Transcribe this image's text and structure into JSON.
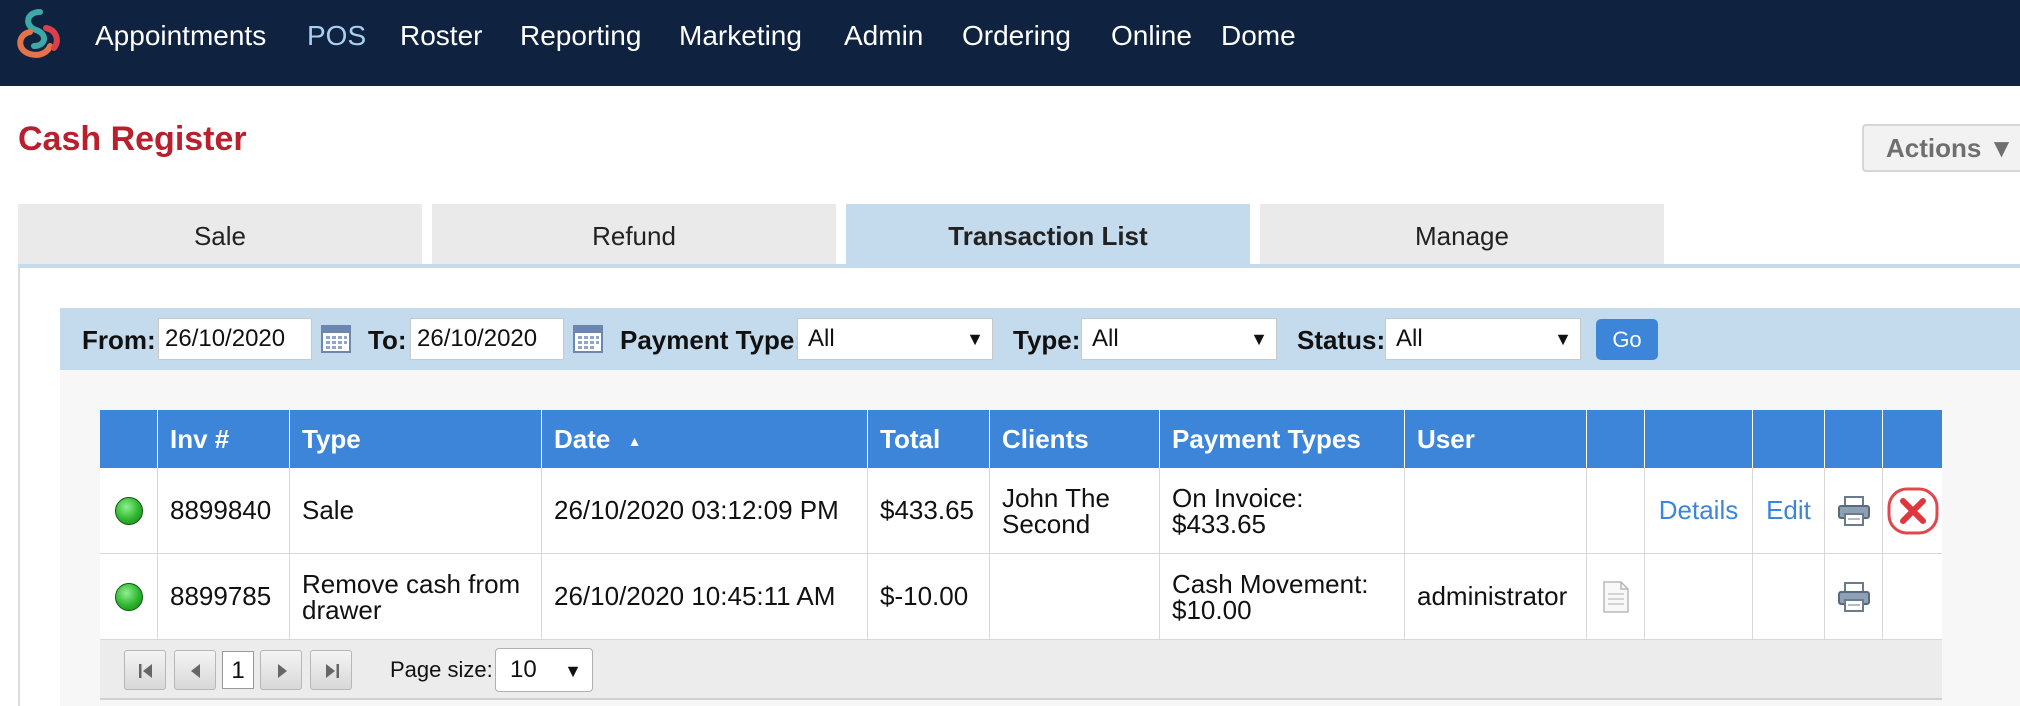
{
  "nav": {
    "items": [
      "Appointments",
      "POS",
      "Roster",
      "Reporting",
      "Marketing",
      "Admin",
      "Ordering",
      "Online",
      "Dome"
    ],
    "active": "POS"
  },
  "page": {
    "title": "Cash Register",
    "actions_label": "Actions ▼"
  },
  "tabs": [
    "Sale",
    "Refund",
    "Transaction List",
    "Manage"
  ],
  "active_tab": "Transaction List",
  "filters": {
    "from_label": "From:",
    "from_value": "26/10/2020",
    "to_label": "To:",
    "to_value": "26/10/2020",
    "payment_type_label": "Payment Type:",
    "payment_type_value": "All",
    "type_label": "Type:",
    "type_value": "All",
    "status_label": "Status:",
    "status_value": "All",
    "go_label": "Go"
  },
  "table": {
    "columns": [
      "",
      "Inv #",
      "Type",
      "Date",
      "Total",
      "Clients",
      "Payment Types",
      "User",
      "",
      "",
      "",
      "",
      ""
    ],
    "sort_indicator": "▲",
    "rows": [
      {
        "status": "green",
        "inv": "8899840",
        "type": "Sale",
        "date": "26/10/2020 03:12:09 PM",
        "total": "$433.65",
        "clients": "John The Second",
        "payment_types": "On Invoice: $433.65",
        "user": "",
        "details_label": "Details",
        "edit_label": "Edit"
      },
      {
        "status": "green",
        "inv": "8899785",
        "type": "Remove cash from drawer",
        "date": "26/10/2020 10:45:11 AM",
        "total": "$-10.00",
        "clients": "",
        "payment_types": "Cash Movement: $10.00",
        "user": "administrator",
        "details_label": "",
        "edit_label": ""
      }
    ]
  },
  "pager": {
    "current_page": "1",
    "page_size_label": "Page size:",
    "page_size_value": "10"
  },
  "colors": {
    "nav_bg": "#0f2340",
    "title_red": "#b8202e",
    "header_blue": "#3d85d8",
    "tab_active": "#c4dbee"
  }
}
